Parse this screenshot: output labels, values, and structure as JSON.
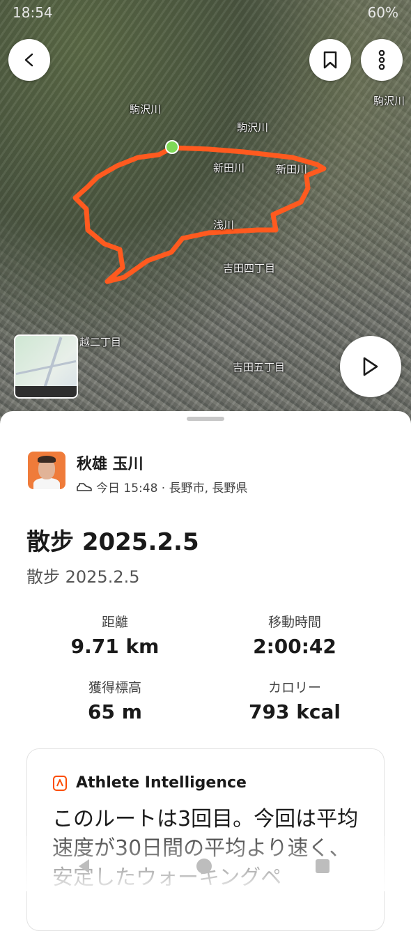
{
  "status_bar": {
    "time": "18:54",
    "battery": "60%"
  },
  "map": {
    "labels": [
      "駒沢川",
      "駒沢川",
      "駒沢川",
      "新田川",
      "新田川",
      "浅川",
      "吉田四丁目",
      "吉田五丁目",
      "越二丁目"
    ],
    "route_color": "#ff5a1f",
    "start_color": "#7ed957"
  },
  "header": {
    "back_icon": "chevron-left-icon",
    "bookmark_icon": "bookmark-icon",
    "more_icon": "more-vertical-icon",
    "play_icon": "play-icon"
  },
  "athlete": {
    "name": "秋雄 玉川",
    "activity_icon": "walking-shoe-icon",
    "meta": "今日 15:48 · 長野市, 長野県"
  },
  "activity": {
    "title": "散步 2025.2.5",
    "subtitle": "散步 2025.2.5"
  },
  "stats": [
    {
      "label": "距離",
      "value": "9.71 km"
    },
    {
      "label": "移動時間",
      "value": "2:00:42"
    },
    {
      "label": "獲得標高",
      "value": "65 m"
    },
    {
      "label": "カロリー",
      "value": "793 kcal"
    }
  ],
  "intelligence": {
    "title": "Athlete Intelligence",
    "text": "このルートは3回目。今回は平均速度が30日間の平均より速く、安定したウォーキングペ"
  },
  "colors": {
    "accent": "#fc4c02"
  }
}
